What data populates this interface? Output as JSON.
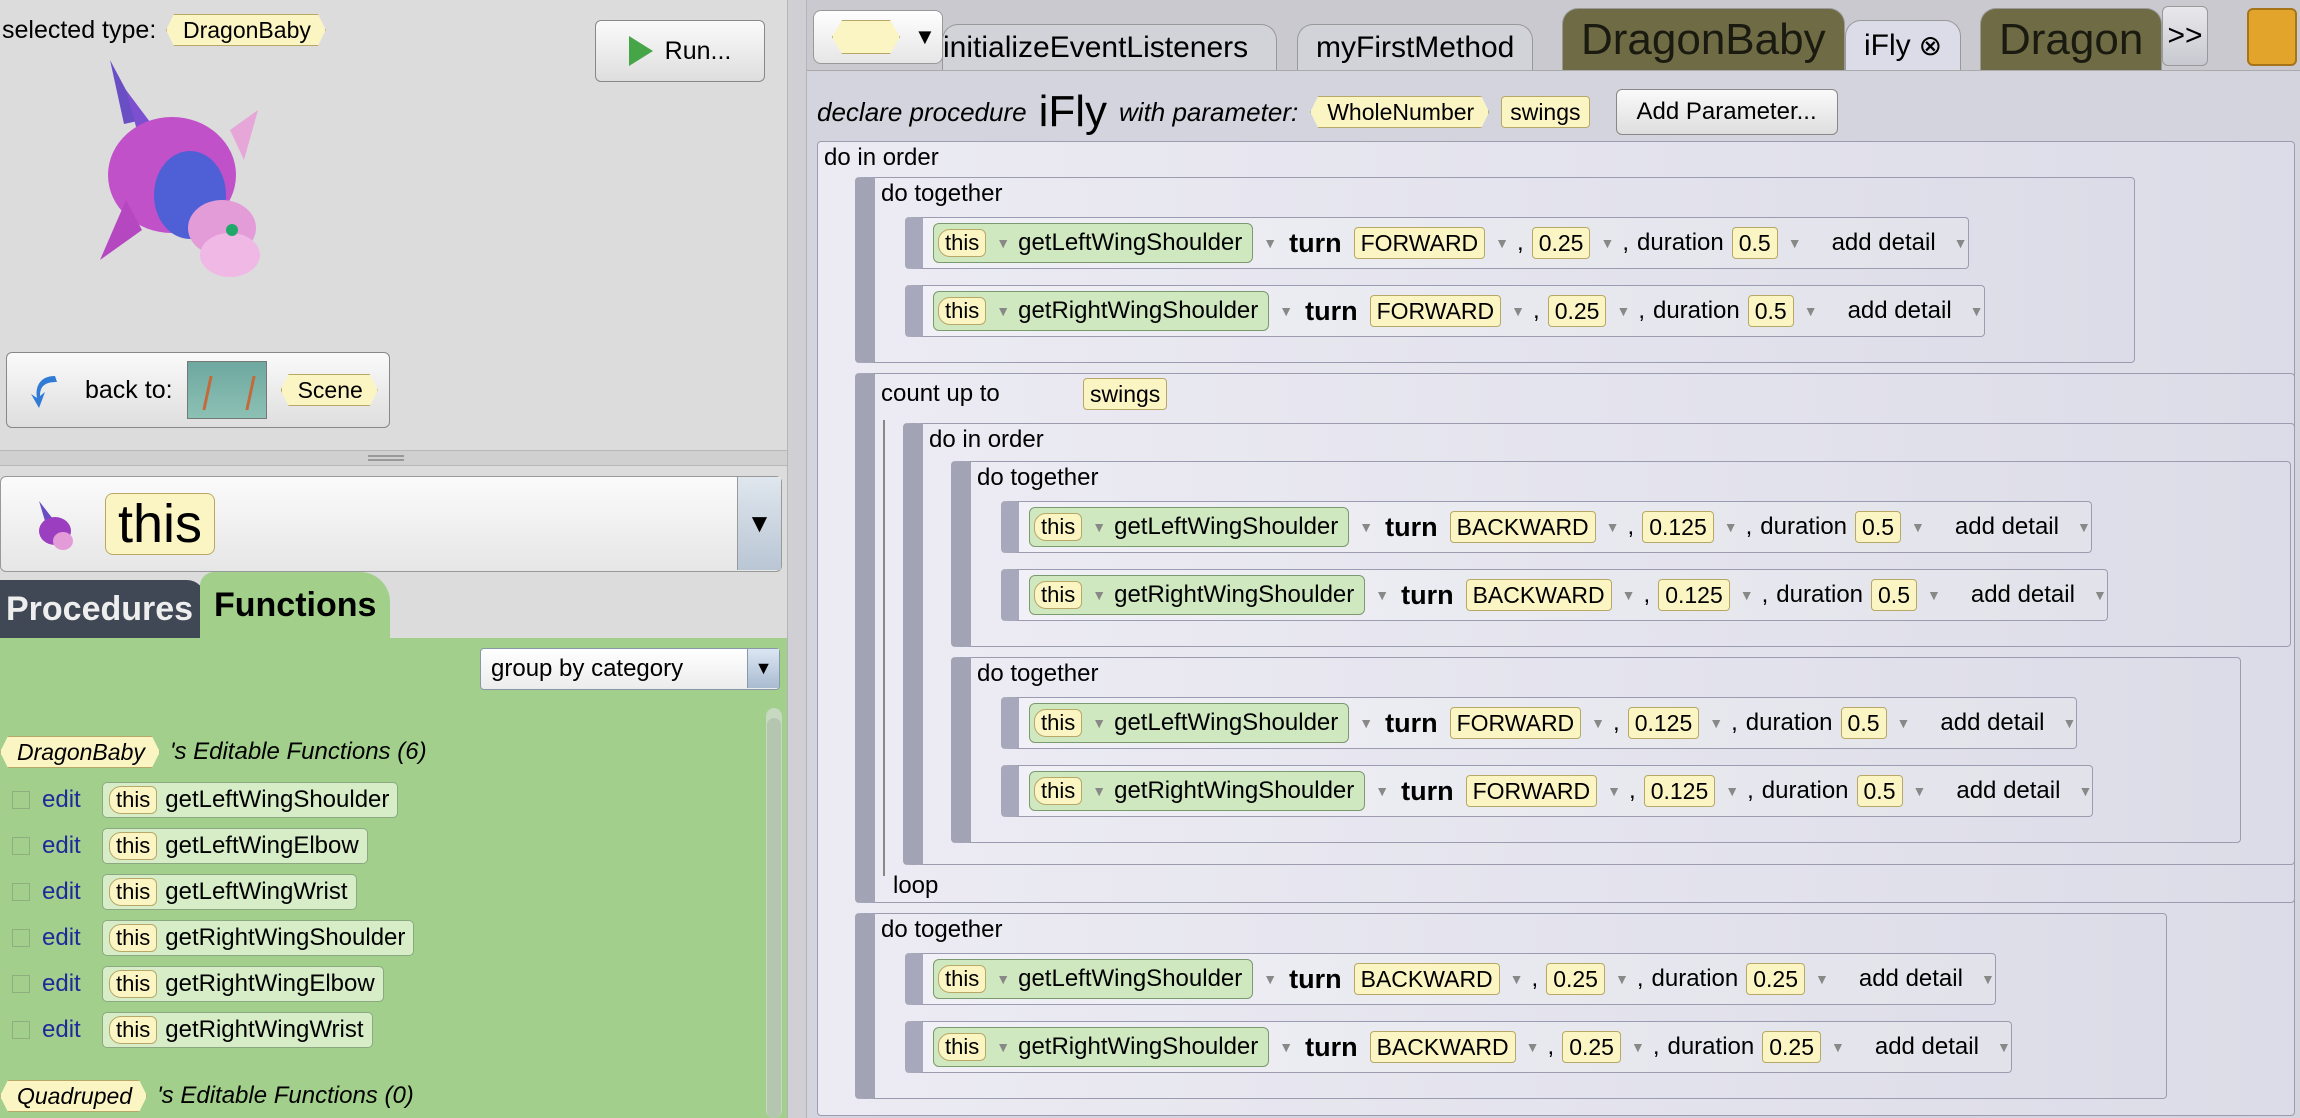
{
  "scene_editor": {
    "selected_type_label": "selected type:",
    "selected_type": "DragonBaby",
    "run_label": "Run...",
    "back_label": "back to:",
    "back_target": "Scene"
  },
  "member_panel": {
    "instance": "this",
    "tabs": [
      "Procedures",
      "Functions"
    ],
    "active_tab": "Functions",
    "group_by": "group by category",
    "sections": [
      {
        "type": "DragonBaby",
        "title": "'s Editable Functions (6)",
        "items": [
          "getLeftWingShoulder",
          "getLeftWingElbow",
          "getLeftWingWrist",
          "getRightWingShoulder",
          "getRightWingElbow",
          "getRightWingWrist"
        ]
      },
      {
        "type": "Quadruped",
        "title": "'s Editable Functions (0)",
        "items": []
      }
    ],
    "edit_label": "edit",
    "this_label": "this"
  },
  "code_editor": {
    "tabs": [
      {
        "label": "initializeEventListeners"
      },
      {
        "label": "myFirstMethod"
      },
      {
        "label": "DragonBaby"
      },
      {
        "label": "iFly"
      },
      {
        "label": "Dragon"
      }
    ],
    "active_tab": "iFly",
    "more": ">>",
    "close_glyph": "⊗",
    "declaration": {
      "prefix": "declare procedure",
      "name": "iFly",
      "middle": "with parameter:",
      "param_type": "WholeNumber",
      "param_name": "swings",
      "add_param": "Add Parameter..."
    },
    "labels": {
      "do_in_order": "do in order",
      "do_together": "do together",
      "count_up_to": "count up to",
      "loop": "loop",
      "turn": "turn",
      "duration": "duration",
      "add_detail": "add detail",
      "comma": ","
    },
    "count_var": "swings",
    "statements": [
      {
        "subject": "this",
        "fn": "getLeftWingShoulder",
        "dir": "FORWARD",
        "amount": "0.25",
        "duration": "0.5"
      },
      {
        "subject": "this",
        "fn": "getRightWingShoulder",
        "dir": "FORWARD",
        "amount": "0.25",
        "duration": "0.5"
      },
      {
        "subject": "this",
        "fn": "getLeftWingShoulder",
        "dir": "BACKWARD",
        "amount": "0.125",
        "duration": "0.5"
      },
      {
        "subject": "this",
        "fn": "getRightWingShoulder",
        "dir": "BACKWARD",
        "amount": "0.125",
        "duration": "0.5"
      },
      {
        "subject": "this",
        "fn": "getLeftWingShoulder",
        "dir": "FORWARD",
        "amount": "0.125",
        "duration": "0.5"
      },
      {
        "subject": "this",
        "fn": "getRightWingShoulder",
        "dir": "FORWARD",
        "amount": "0.125",
        "duration": "0.5"
      },
      {
        "subject": "this",
        "fn": "getLeftWingShoulder",
        "dir": "BACKWARD",
        "amount": "0.25",
        "duration": "0.25"
      },
      {
        "subject": "this",
        "fn": "getRightWingShoulder",
        "dir": "BACKWARD",
        "amount": "0.25",
        "duration": "0.25"
      }
    ]
  }
}
